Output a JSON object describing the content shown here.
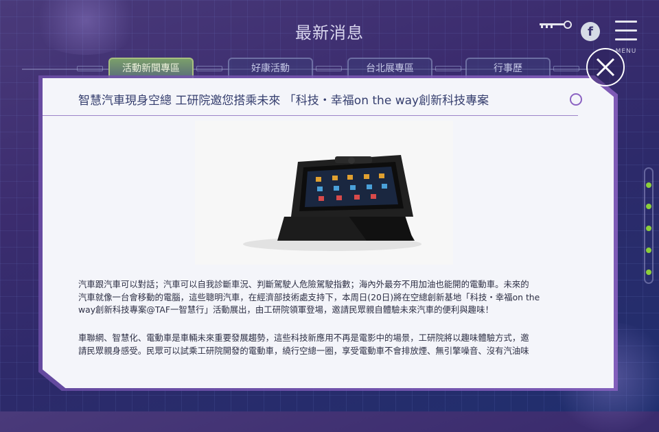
{
  "header": {
    "title": "最新消息",
    "menu_label": "MENU"
  },
  "tabs": [
    {
      "label": "活動新聞專區",
      "active": true
    },
    {
      "label": "好康活動",
      "active": false
    },
    {
      "label": "台北展專區",
      "active": false
    },
    {
      "label": "行事歷",
      "active": false
    }
  ],
  "article": {
    "title": "智慧汽車現身空總 工研院邀您搭乘未來 「科技・幸福on the way創新科技專案",
    "paragraphs": [
      [
        "汽車跟汽車可以對話；汽車可以自我診斷車況、判斷駕駛人危險駕駛指數；海內外最夯不用加油也能開的電動車。未來的",
        "汽車就像一台會移動的電腦，這些聰明汽車，在經濟部技術處支持下，本周日(20日)將在空總創新基地「科技・幸福on the",
        "way創新科技專案@TAF一智慧行」活動展出，由工研院領軍登場，邀請民眾親自體驗未來汽車的便利與趣味！"
      ],
      [
        "車聯網、智慧化、電動車是車輛未來重要發展趨勢，這些科技新應用不再是電影中的場景，工研院將以趣味體驗方式，邀",
        "請民眾親身感受。民眾可以試乘工研院開發的電動車，繞行空總一圈，享受電動車不會排放煙、無引擎噪音、沒有汽油味"
      ]
    ]
  },
  "colors": {
    "accent_purple": "#8b62c2",
    "active_tab": "#7a9e6a",
    "scroll_dot": "#8ccf3a"
  }
}
